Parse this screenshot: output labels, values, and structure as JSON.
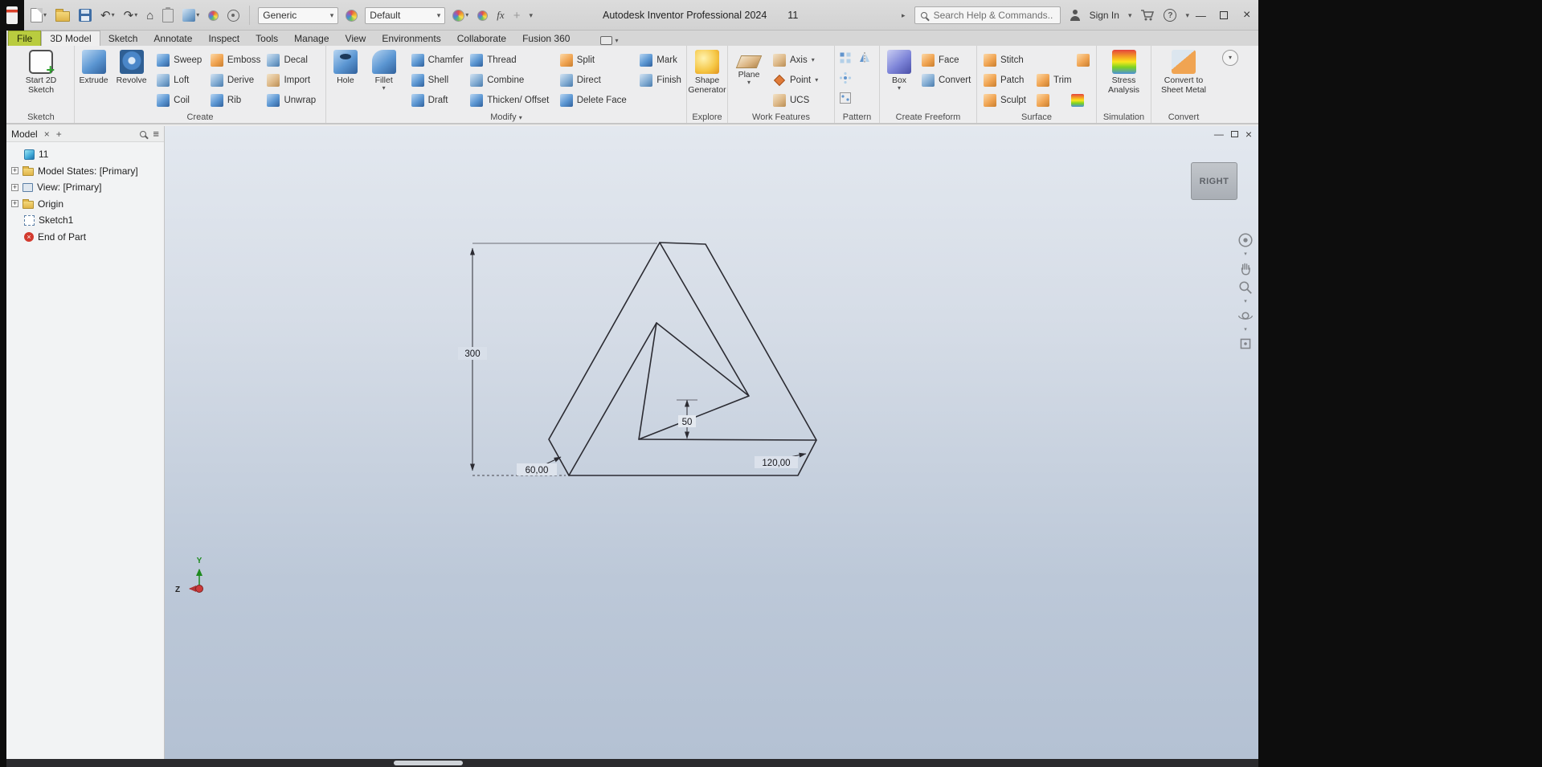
{
  "glyphs": {
    "dropdown": "▾",
    "chevron_right": "▸",
    "close": "×",
    "minimize": "—",
    "plus": "+",
    "hamburger": "≡",
    "undo": "↶",
    "redo": "↷",
    "home": "⌂",
    "question": "?",
    "fx": "fx"
  },
  "titlebar": {
    "app_title": "Autodesk Inventor Professional 2024",
    "document_name": "11",
    "material_select": "Generic",
    "appearance_select": "Default",
    "search_placeholder": "Search Help & Commands...",
    "sign_in": "Sign In"
  },
  "tabs": {
    "items": [
      "File",
      "3D Model",
      "Sketch",
      "Annotate",
      "Inspect",
      "Tools",
      "Manage",
      "View",
      "Environments",
      "Collaborate",
      "Fusion 360"
    ],
    "active": "3D Model"
  },
  "ribbon": {
    "sketch_group": {
      "label": "Sketch",
      "start_2d_sketch": "Start 2D Sketch"
    },
    "create_group": {
      "label": "Create",
      "extrude": "Extrude",
      "revolve": "Revolve",
      "small": [
        "Sweep",
        "Loft",
        "Coil",
        "Emboss",
        "Derive",
        "Rib",
        "Decal",
        "Import",
        "Unwrap"
      ]
    },
    "modify_group": {
      "label": "Modify",
      "hole": "Hole",
      "fillet": "Fillet",
      "small": [
        "Chamfer",
        "Shell",
        "Draft",
        "Thread",
        "Combine",
        "Thicken/ Offset",
        "Split",
        "Direct",
        "Delete Face",
        "Mark",
        "Finish"
      ]
    },
    "explore_group": {
      "label": "Explore",
      "shape_generator": "Shape Generator"
    },
    "work_features_group": {
      "label": "Work Features",
      "plane": "Plane",
      "axis": "Axis",
      "point": "Point",
      "ucs": "UCS"
    },
    "pattern_group": {
      "label": "Pattern"
    },
    "create_freeform_group": {
      "label": "Create Freeform",
      "box": "Box",
      "face": "Face",
      "convert": "Convert"
    },
    "surface_group": {
      "label": "Surface",
      "stitch": "Stitch",
      "patch": "Patch",
      "sculpt": "Sculpt",
      "trim": "Trim"
    },
    "simulation_group": {
      "label": "Simulation",
      "stress_analysis": "Stress Analysis"
    },
    "convert_group": {
      "label": "Convert",
      "convert_to_sheet_metal": "Convert to Sheet Metal"
    }
  },
  "browser": {
    "panel_tab": "Model",
    "tree": [
      {
        "label": "11"
      },
      {
        "label": "Model States: [Primary]"
      },
      {
        "label": "View: [Primary]"
      },
      {
        "label": "Origin"
      },
      {
        "label": "Sketch1"
      },
      {
        "label": "End of Part"
      }
    ]
  },
  "viewport": {
    "viewcube_face": "RIGHT",
    "dimensions": {
      "overall_height": "300",
      "bar_width": "50",
      "angle_left": "60,00",
      "angle_right": "120,00"
    },
    "triad": {
      "y_label": "Y",
      "z_label": "Z"
    }
  }
}
